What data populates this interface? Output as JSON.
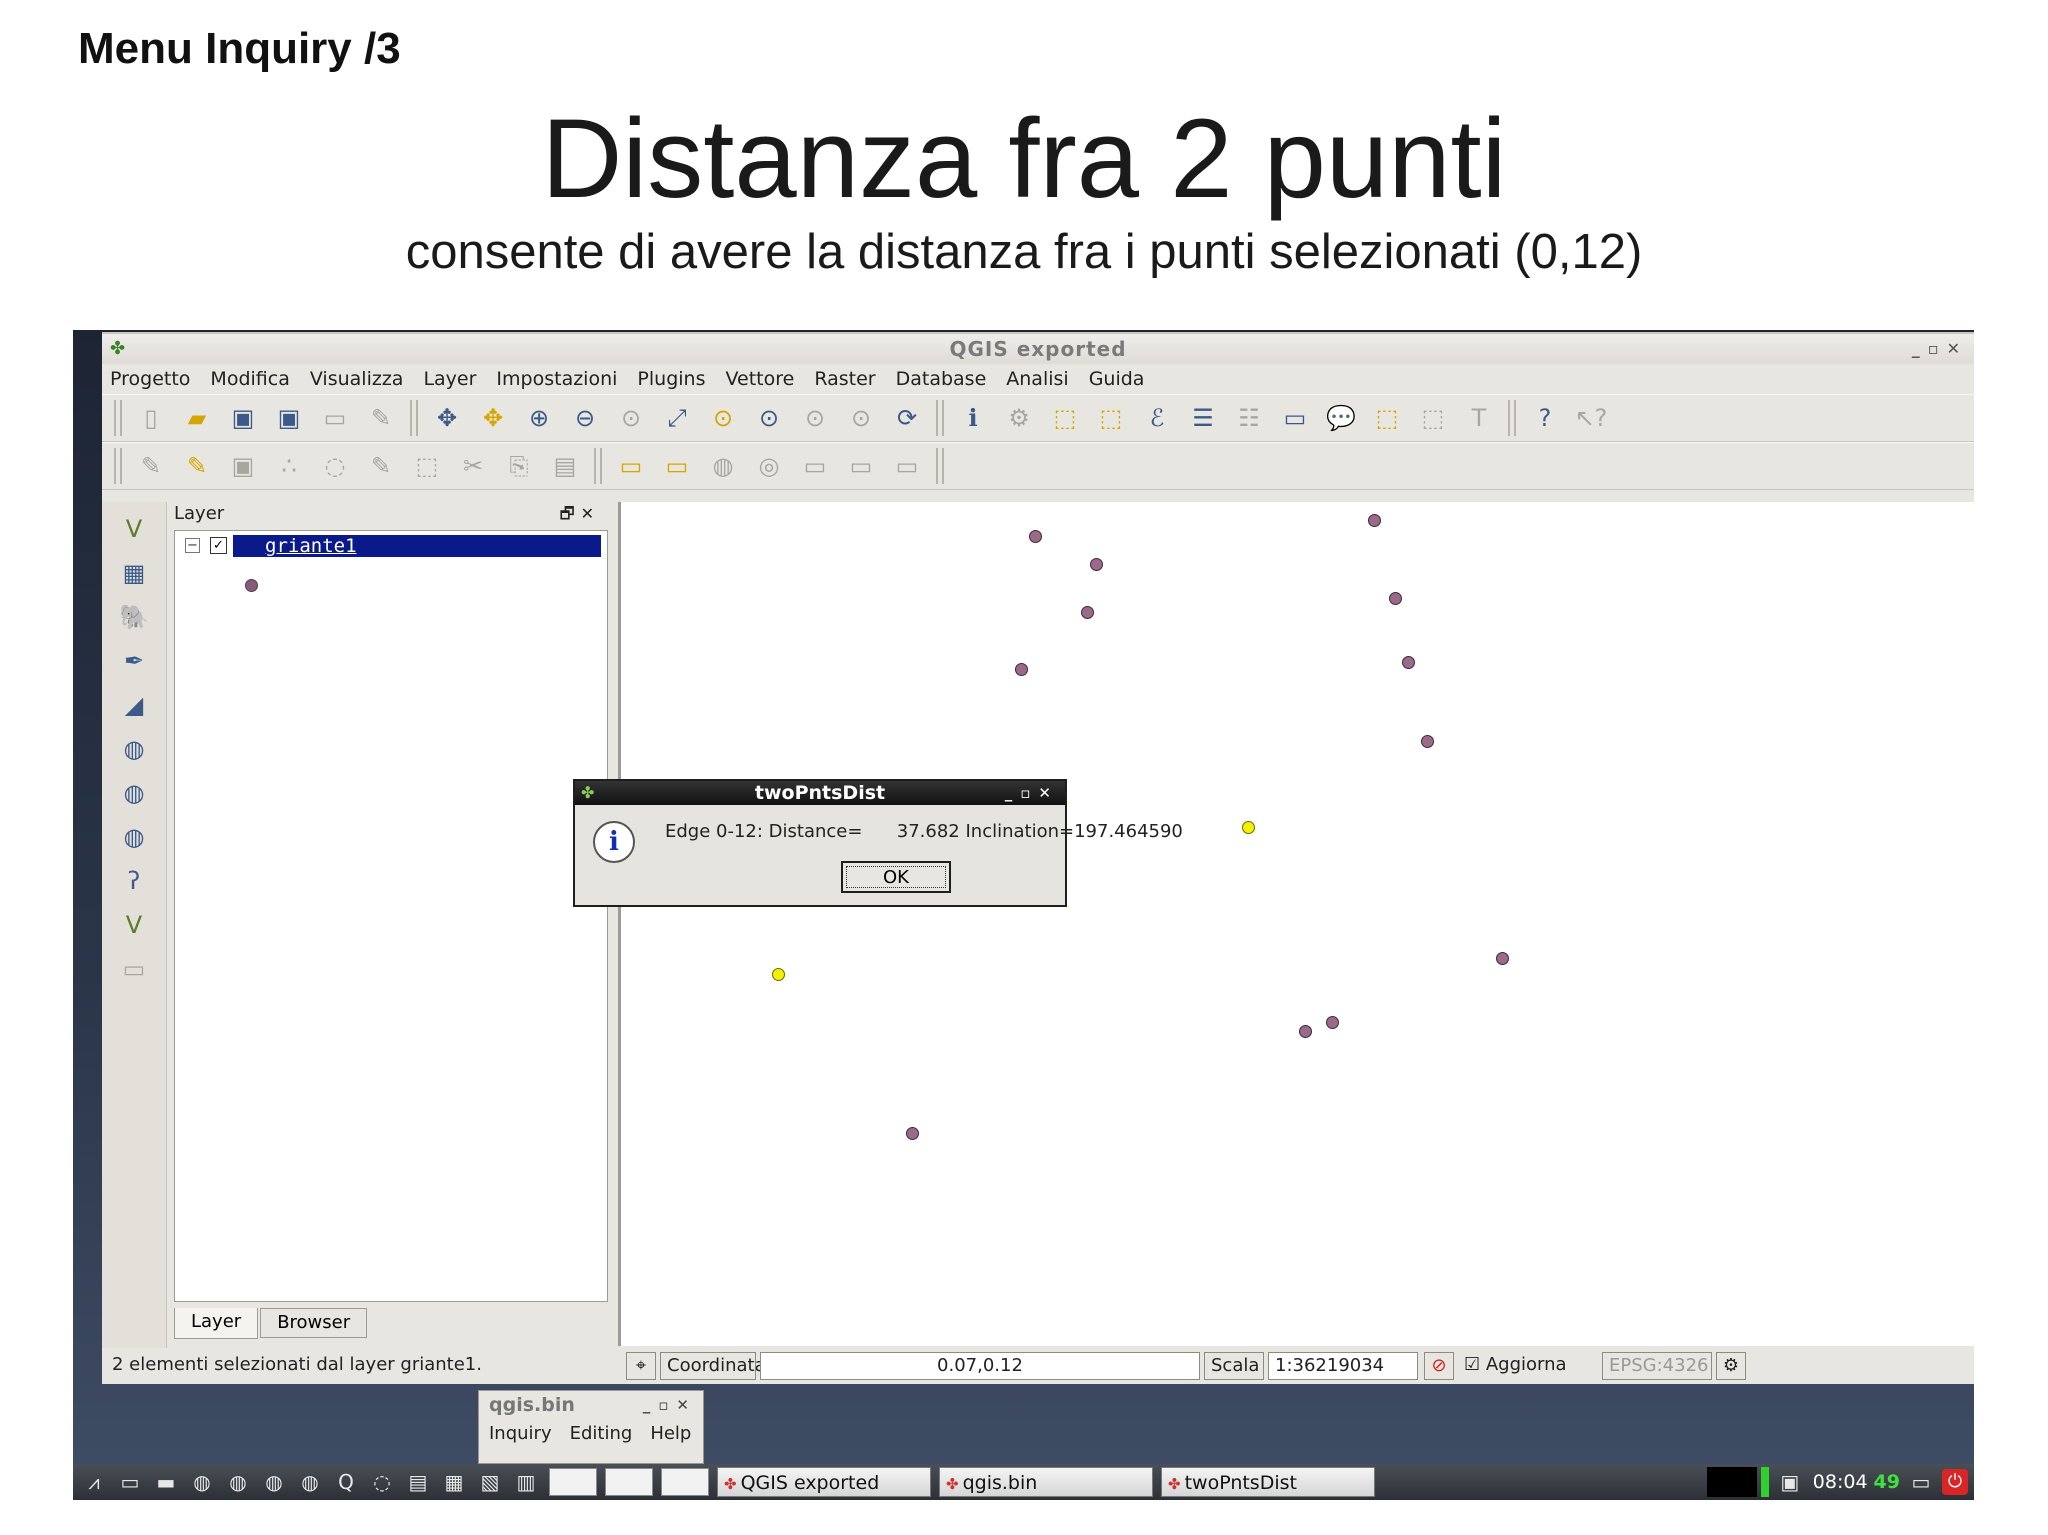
{
  "slide": {
    "header": "Menu Inquiry /3",
    "title": "Distanza fra 2 punti",
    "subtitle": "consente di avere la distanza fra i punti selezionati (0,12)"
  },
  "window": {
    "title": "QGIS exported",
    "menu": [
      "Progetto",
      "Modifica",
      "Visualizza",
      "Layer",
      "Impostazioni",
      "Plugins",
      "Vettore",
      "Raster",
      "Database",
      "Analisi",
      "Guida"
    ]
  },
  "layer_panel": {
    "title": "Layer",
    "layer_name": "griante1",
    "tabs": [
      "Layer",
      "Browser"
    ]
  },
  "dialog": {
    "title": "twoPntsDist",
    "message": "Edge 0-12: Distance=      37.682 Inclination=197.464590",
    "ok_label": "OK"
  },
  "statusbar": {
    "message": "2 elementi selezionati dal layer griante1.",
    "coord_label": "Coordinata:",
    "coord_value": "0.07,0.12",
    "scale_label": "Scala",
    "scale_value": "1:36219034",
    "render_label": "Aggiorna",
    "crs": "EPSG:4326"
  },
  "mini_window": {
    "title": "qgis.bin",
    "menu": [
      "Inquiry",
      "Editing",
      "Help"
    ]
  },
  "taskbar": {
    "tasks": [
      "QGIS exported",
      "qgis.bin",
      "twoPntsDist"
    ],
    "clock": "08:04",
    "counter": "49"
  },
  "colors": {
    "selection": "#0a1a8a",
    "point": "#9a6a88",
    "selected_point": "#f4f000"
  }
}
